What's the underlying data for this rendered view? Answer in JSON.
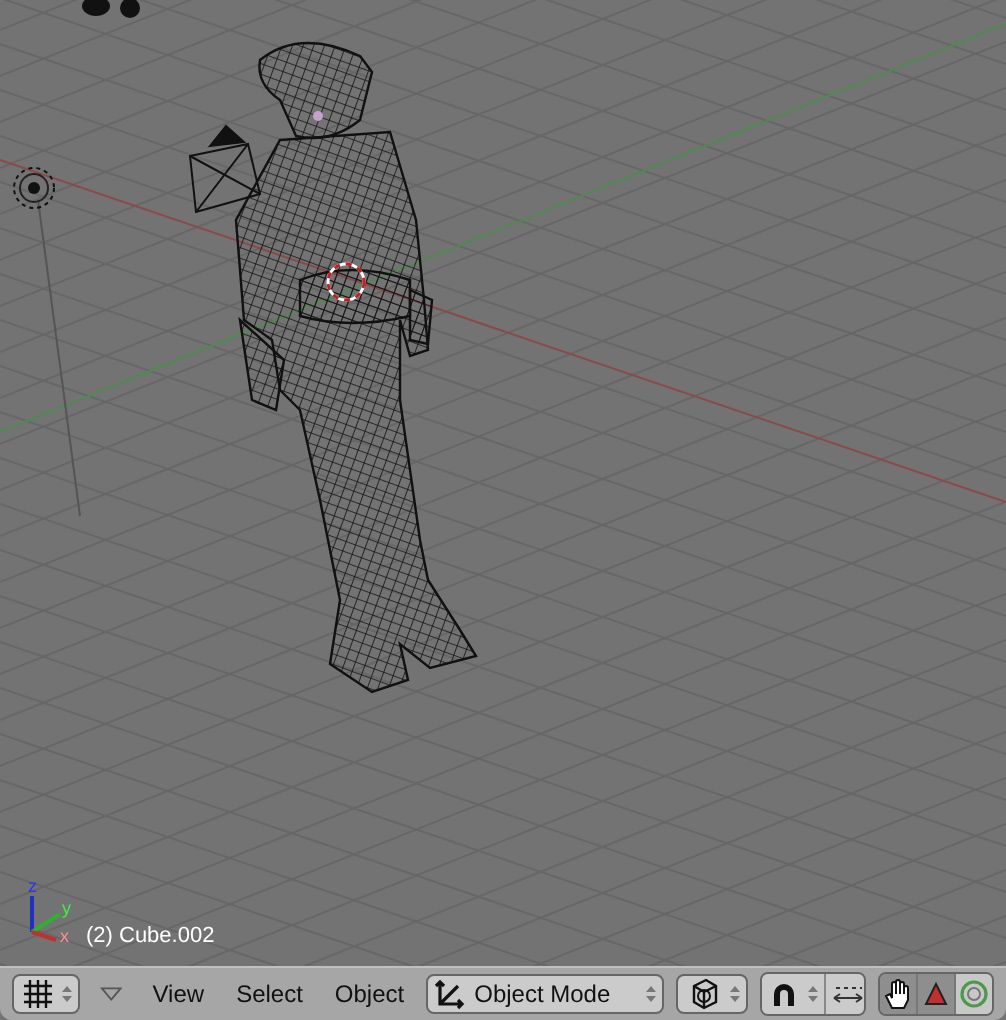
{
  "viewport": {
    "object_label": "(2) Cube.002",
    "gizmo_axes": [
      "z",
      "y",
      "x"
    ]
  },
  "header": {
    "menus": [
      "View",
      "Select",
      "Object"
    ],
    "mode": {
      "label": "Object Mode"
    },
    "manipulators": [
      {
        "kind": "hand",
        "selected": true
      },
      {
        "kind": "translate",
        "selected": true
      },
      {
        "kind": "rotate",
        "selected": false
      }
    ]
  }
}
